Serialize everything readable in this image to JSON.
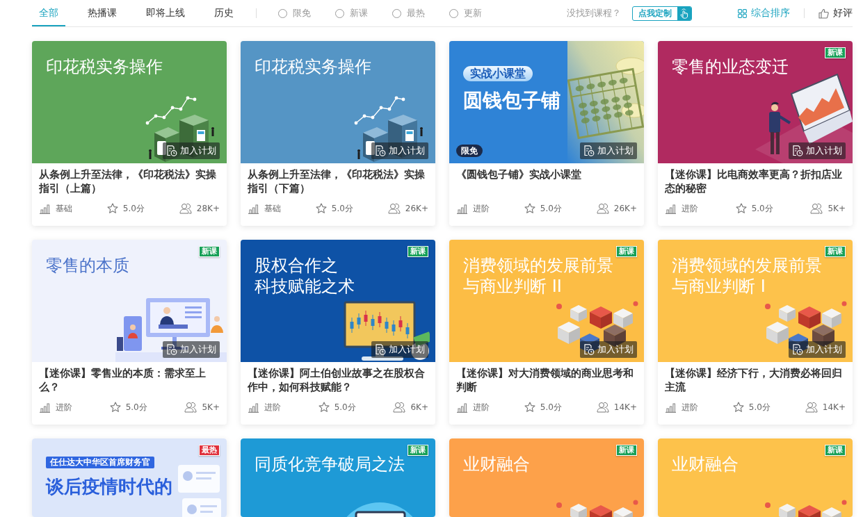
{
  "tabs": [
    {
      "label": "全部",
      "selected": true
    },
    {
      "label": "热播课",
      "selected": false
    },
    {
      "label": "即将上线",
      "selected": false
    },
    {
      "label": "历史",
      "selected": false
    }
  ],
  "filters": [
    {
      "label": "限免",
      "selected": false
    },
    {
      "label": "新课",
      "selected": false
    },
    {
      "label": "最热",
      "selected": false
    },
    {
      "label": "更新",
      "selected": false
    }
  ],
  "request": {
    "prompt": "没找到课程？",
    "button": "点我定制"
  },
  "sort": [
    {
      "kind": "overall",
      "label": "综合排序",
      "selected": true
    },
    {
      "kind": "rating",
      "label": "好评",
      "selected": false
    }
  ],
  "cards": [
    {
      "cover": {
        "kind": "tax",
        "color": "#5ea65a",
        "title": [
          "印花税实务操作"
        ]
      },
      "plan_button": "加入计划",
      "title": "从条例上升至法律，《印花税法》实操指引（上篇）",
      "difficulty": "基础",
      "rating": "5.0分",
      "learners": "28K+"
    },
    {
      "cover": {
        "kind": "tax",
        "color": "#5595c5",
        "title": [
          "印花税实务操作"
        ]
      },
      "plan_button": "加入计划",
      "title": "从条例上升至法律，《印花税法》实操指引（下篇）",
      "difficulty": "基础",
      "rating": "5.0分",
      "learners": "26K+"
    },
    {
      "cover": {
        "kind": "abacus",
        "color": "#2f83d6",
        "tag": "实战小课堂",
        "title": [
          "圆钱包子铺"
        ]
      },
      "tag": "限免",
      "plan_button": "加入计划",
      "title": "《圆钱包子铺》实战小课堂",
      "difficulty": "进阶",
      "rating": "5.0分",
      "learners": "26K+"
    },
    {
      "cover": {
        "kind": "laptop",
        "color": "#b02a60",
        "title": [
          "零售的业态变迁"
        ]
      },
      "badge": {
        "kind": "new",
        "label": "新课"
      },
      "plan_button": "加入计划",
      "title": "【迷你课】比电商效率更高？折扣店业态的秘密",
      "difficulty": "进阶",
      "rating": "5.0分",
      "learners": "5K+"
    },
    {
      "cover": {
        "kind": "classroom",
        "color": "#eff2fc",
        "title": [
          "零售的本质"
        ]
      },
      "badge": {
        "kind": "new",
        "label": "新课"
      },
      "plan_button": "加入计划",
      "title": "【迷你课】零售业的本质：需求至上么？",
      "difficulty": "进阶",
      "rating": "5.0分",
      "learners": "5K+"
    },
    {
      "cover": {
        "kind": "candlestick",
        "color": "#0e52a6",
        "title": [
          "股权合作之",
          "科技赋能之术"
        ]
      },
      "badge": {
        "kind": "new",
        "label": "新课"
      },
      "plan_button": "加入计划",
      "title": "【迷你课】阿土伯创业故事之在股权合作中，如何科技赋能？",
      "difficulty": "进阶",
      "rating": "5.0分",
      "learners": "6K+"
    },
    {
      "cover": {
        "kind": "boxes",
        "color": "#fcbd45",
        "title": [
          "消费领域的发展前景",
          "与商业判断 II"
        ]
      },
      "badge": {
        "kind": "new",
        "label": "新课"
      },
      "plan_button": "加入计划",
      "title": "【迷你课】对大消费领域的商业思考和判断",
      "difficulty": "进阶",
      "rating": "5.0分",
      "learners": "14K+"
    },
    {
      "cover": {
        "kind": "boxes",
        "color": "#fdc24b",
        "title": [
          "消费领域的发展前景",
          "与商业判断 I"
        ]
      },
      "badge": {
        "kind": "new",
        "label": "新课"
      },
      "plan_button": "加入计划",
      "title": "【迷你课】经济下行，大消费必将回归主流",
      "difficulty": "进阶",
      "rating": "5.0分",
      "learners": "14K+"
    },
    {
      "cover": {
        "kind": "flyer",
        "color": "#dce6fa",
        "tag": "任仕达大中华区首席财务官",
        "title": [
          "谈后疫情时代的"
        ]
      },
      "badge": {
        "kind": "hot",
        "label": "最热"
      }
    },
    {
      "cover": {
        "kind": "circle",
        "color": "#1e9ad6",
        "title": [
          "同质化竞争破局之法"
        ]
      },
      "badge": {
        "kind": "new",
        "label": "新课"
      }
    },
    {
      "cover": {
        "kind": "boxes",
        "color": "#fda14a",
        "title": [
          "业财融合"
        ]
      },
      "badge": {
        "kind": "new",
        "label": "新课"
      }
    },
    {
      "cover": {
        "kind": "boxes",
        "color": "#fdc24b",
        "title": [
          "业财融合"
        ]
      },
      "badge": {
        "kind": "new",
        "label": "新课"
      }
    }
  ]
}
